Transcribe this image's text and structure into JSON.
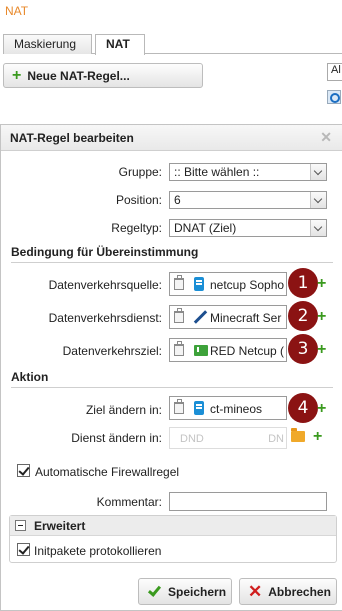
{
  "app_title": "NAT",
  "tabs": [
    {
      "label": "Maskierung",
      "active": false
    },
    {
      "label": "NAT",
      "active": true
    }
  ],
  "toolbar": {
    "new_rule_label": "Neue NAT-Regel...",
    "right_button_text": "Al"
  },
  "dialog": {
    "title": "NAT-Regel bearbeiten",
    "fields": {
      "group": {
        "label": "Gruppe:",
        "value": ":: Bitte wählen ::"
      },
      "position": {
        "label": "Position:",
        "value": "6"
      },
      "rule_type": {
        "label": "Regeltyp:",
        "value": "DNAT (Ziel)"
      }
    },
    "match_section": {
      "title": "Bedingung für Übereinstimmung",
      "source": {
        "label": "Datenverkehrsquelle:",
        "value": "netcup Sopho",
        "icon": "host-icon",
        "badge": "1"
      },
      "service": {
        "label": "Datenverkehrsdienst:",
        "value": "Minecraft Ser",
        "icon": "service-icon",
        "badge": "2"
      },
      "destination": {
        "label": "Datenverkehrsziel:",
        "value": "RED Netcup (",
        "icon": "red-network-icon",
        "badge": "3"
      }
    },
    "action_section": {
      "title": "Aktion",
      "change_target": {
        "label": "Ziel ändern in:",
        "value": "ct-mineos",
        "icon": "host-icon",
        "badge": "4"
      },
      "change_service": {
        "label": "Dienst ändern in:",
        "placeholder_left": "DND",
        "placeholder_right": "DN"
      }
    },
    "auto_firewall": {
      "label": "Automatische Firewallregel",
      "checked": true
    },
    "comment": {
      "label": "Kommentar:",
      "value": ""
    },
    "advanced": {
      "title": "Erweitert",
      "log_initial": {
        "label": "Initpakete protokollieren",
        "checked": true
      }
    },
    "buttons": {
      "save": "Speichern",
      "cancel": "Abbrechen"
    }
  },
  "colors": {
    "accent": "#e8892b",
    "badge": "#8b1313",
    "plus": "#3a9a1e",
    "cancel": "#d01e1e"
  }
}
